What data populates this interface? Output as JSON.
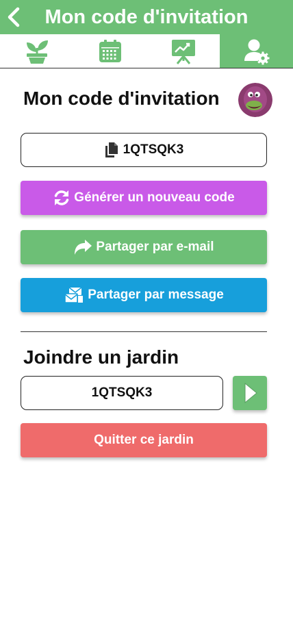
{
  "header": {
    "title": "Mon code d'invitation",
    "bg_color": "#6dbf76",
    "back_icon": "chevron-left-icon"
  },
  "tabs": [
    {
      "icon": "plant-icon",
      "active": false
    },
    {
      "icon": "calendar-icon",
      "active": false
    },
    {
      "icon": "chart-board-icon",
      "active": false
    },
    {
      "icon": "user-settings-icon",
      "active": true
    }
  ],
  "invitation": {
    "title": "Mon code d'invitation",
    "code": "1QTSQK3",
    "copy_icon": "copy-icon",
    "avatar": "user-avatar"
  },
  "actions": {
    "generate_label": "Générer un nouveau code",
    "generate_color": "#c95ae8",
    "email_label": "Partager par e-mail",
    "email_color": "#6dbf76",
    "message_label": "Partager par message",
    "message_color": "#179fdb"
  },
  "join": {
    "title": "Joindre un jardin",
    "input_value": "1QTSQK3",
    "go_color": "#6dbf76",
    "quit_label": "Quitter ce jardin",
    "quit_color": "#ef6b6b"
  }
}
